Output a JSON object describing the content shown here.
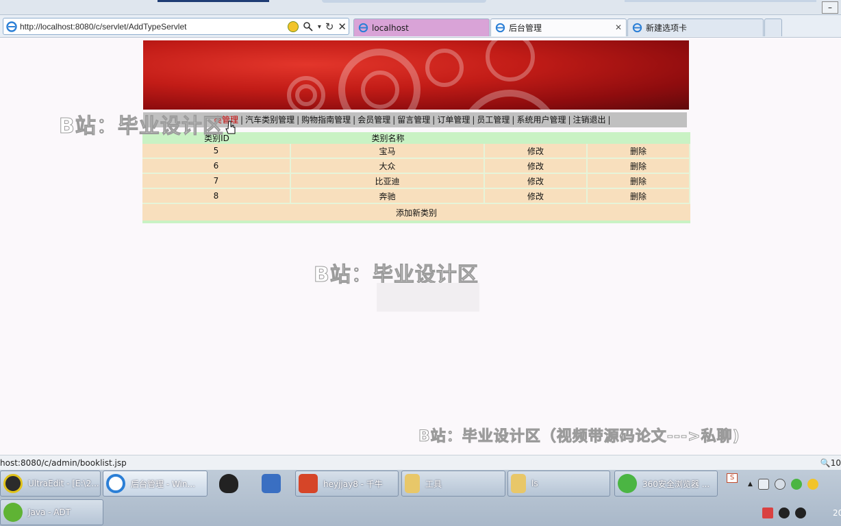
{
  "browser": {
    "address_url": "http://localhost:8080/c/servlet/AddTypeServlet",
    "tabs": [
      {
        "label": "localhost"
      },
      {
        "label": "后台管理"
      },
      {
        "label": "新建选项卡"
      }
    ],
    "status_text": "host:8080/c/admin/booklist.jsp",
    "zoom_text": "10"
  },
  "menu": {
    "items": [
      "类管理",
      "汽车类别管理",
      "购物指南管理",
      "会员管理",
      "留言管理",
      "订单管理",
      "员工管理",
      "系统用户管理",
      "注销退出"
    ],
    "separator": "|"
  },
  "table": {
    "headers": [
      "类别ID",
      "类别名称"
    ],
    "rows": [
      {
        "id": "5",
        "name": "宝马",
        "edit": "修改",
        "delete": "删除"
      },
      {
        "id": "6",
        "name": "大众",
        "edit": "修改",
        "delete": "删除"
      },
      {
        "id": "7",
        "name": "比亚迪",
        "edit": "修改",
        "delete": "删除"
      },
      {
        "id": "8",
        "name": "奔驰",
        "edit": "修改",
        "delete": "删除"
      }
    ],
    "add_label": "添加新类别"
  },
  "watermarks": {
    "left": "B站：毕业设计区",
    "center": "B站：毕业设计区",
    "bottom": "B站：毕业设计区（视频带源码论文--->私聊)"
  },
  "taskbar": {
    "items": [
      {
        "label": "UltraEdit - [E:\\2...",
        "icon": "ultraedit-icon"
      },
      {
        "label": "后台管理 - Win...",
        "icon": "ie-icon"
      },
      {
        "label": "",
        "icon": "qq-icon"
      },
      {
        "label": "",
        "icon": "network-icon"
      },
      {
        "label": "heyjjay8 - 千牛",
        "icon": "qianniu-icon"
      },
      {
        "label": "工具",
        "icon": "folder-icon"
      },
      {
        "label": "ls",
        "icon": "folder-icon"
      },
      {
        "label": "360安全浏览器 ...",
        "icon": "360-browser-icon"
      },
      {
        "label": "Java - ADT",
        "icon": "adt-icon"
      }
    ],
    "clock_text": "20"
  },
  "colors": {
    "menu_active": "#c40000",
    "table_header": "#c9f2c4",
    "table_row": "#f8dfbd",
    "banner": "#c21c17"
  }
}
